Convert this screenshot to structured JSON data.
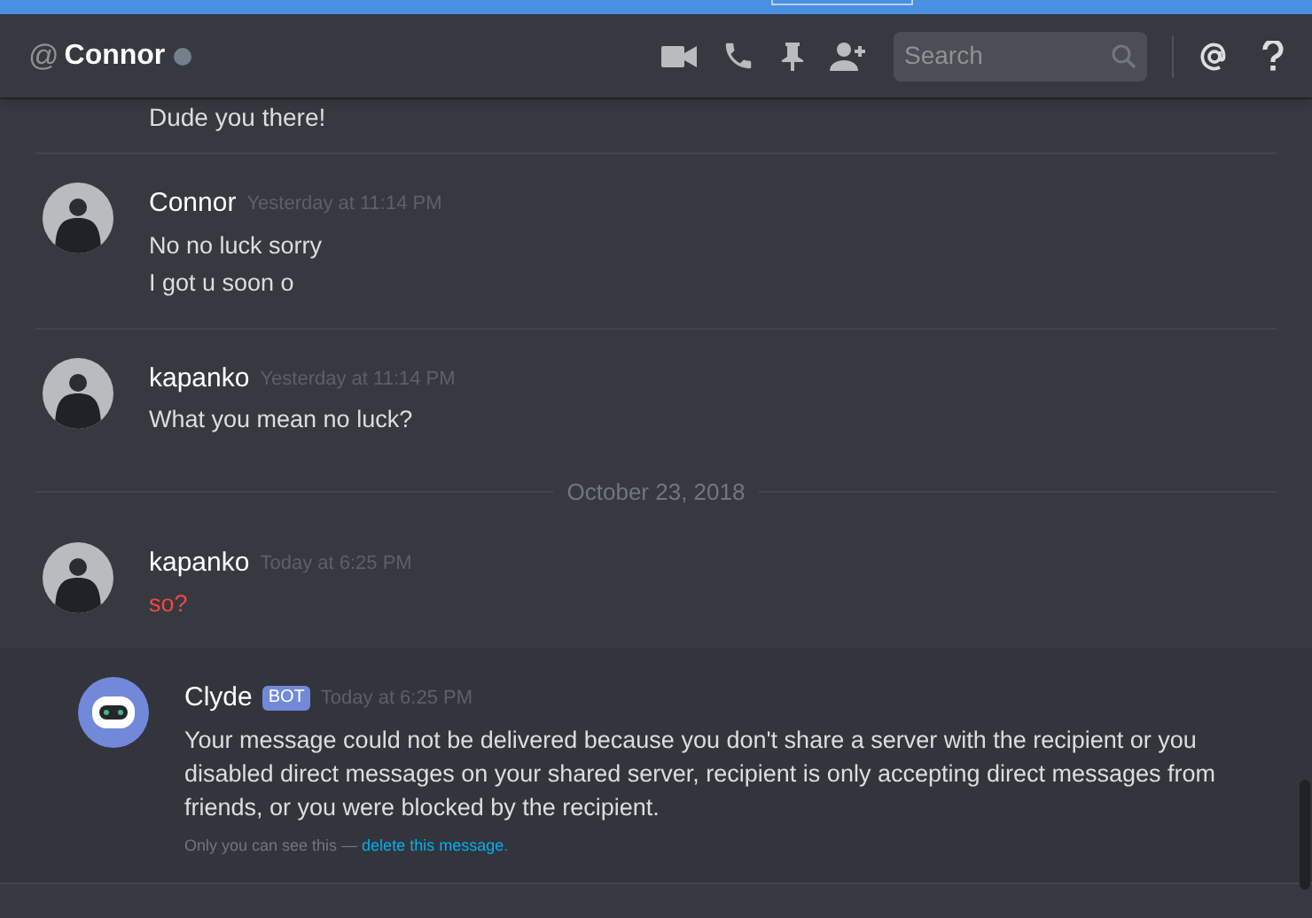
{
  "header": {
    "at_sign": "@",
    "title": "Connor",
    "search": {
      "placeholder": "Search"
    }
  },
  "messages": [
    {
      "kind": "continuation",
      "lines": [
        "Dude you there!"
      ]
    },
    {
      "kind": "divider"
    },
    {
      "kind": "group",
      "author": "Connor",
      "time": "Yesterday at 11:14 PM",
      "lines": [
        "No no luck sorry",
        "I got u soon o"
      ]
    },
    {
      "kind": "divider"
    },
    {
      "kind": "group",
      "author": "kapanko",
      "time": "Yesterday at 11:14 PM",
      "lines": [
        "What you mean no luck?"
      ]
    },
    {
      "kind": "date",
      "label": "October 23, 2018"
    },
    {
      "kind": "group",
      "author": "kapanko",
      "time": "Today at 6:25 PM",
      "lines": [
        "so?"
      ],
      "failed": true
    },
    {
      "kind": "system",
      "author": "Clyde",
      "badge": "BOT",
      "time": "Today at 6:25 PM",
      "lines": [
        "Your message could not be delivered because you don't share a server with the recipient or you disabled direct messages on your shared server, recipient is only accepting direct messages from friends, or you were blocked by the recipient."
      ],
      "note": "Only you can see this — ",
      "link": "delete this message",
      "note_end": "."
    }
  ]
}
